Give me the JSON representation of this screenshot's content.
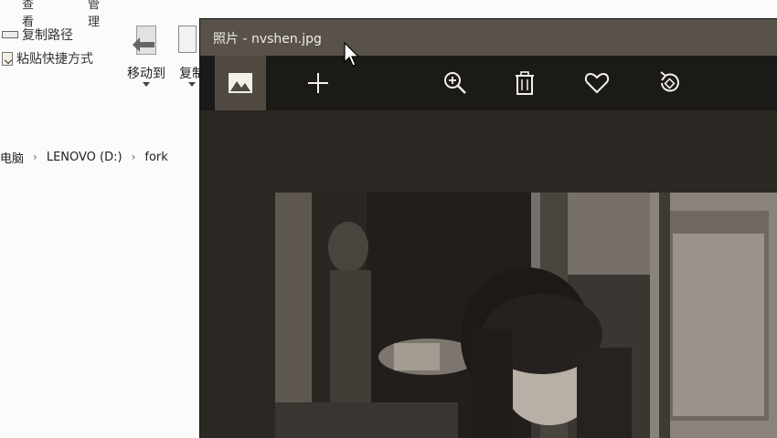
{
  "explorer": {
    "ribbon_tabs": [
      "查看",
      "管理"
    ],
    "clipboard": {
      "copy_path": "复制路径",
      "paste_shortcut": "粘贴快捷方式"
    },
    "organize": {
      "move_to": "移动到",
      "copy_to": "复制"
    },
    "breadcrumb": [
      "电脑",
      "LENOVO (D:)",
      "fork"
    ]
  },
  "photos_window": {
    "title": "照片 - nvshen.jpg",
    "toolbar": [
      {
        "name": "collection",
        "icon": "picture-icon",
        "active": true
      },
      {
        "name": "add",
        "icon": "plus-icon"
      },
      {
        "name": "zoom",
        "icon": "zoom-in-icon"
      },
      {
        "name": "delete",
        "icon": "trash-icon"
      },
      {
        "name": "favorite",
        "icon": "heart-icon"
      },
      {
        "name": "rotate",
        "icon": "rotate-icon"
      }
    ]
  },
  "colors": {
    "titlebar": "#58524b",
    "toolbar": "#1c1a17",
    "content": "#2b2824",
    "active_tab": "#504a43"
  }
}
